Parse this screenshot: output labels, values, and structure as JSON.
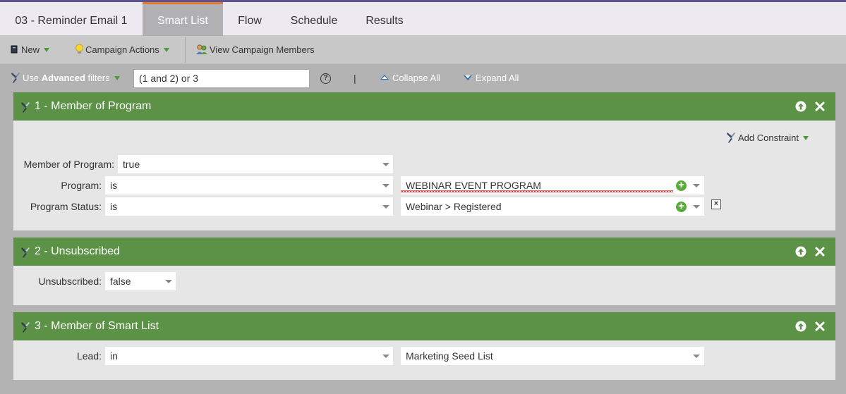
{
  "tabs": {
    "program_title": "03 - Reminder Email 1",
    "items": [
      "Smart List",
      "Flow",
      "Schedule",
      "Results"
    ],
    "active": "Smart List"
  },
  "toolbar": {
    "new_label": "New",
    "campaign_actions_label": "Campaign Actions",
    "view_members_label": "View Campaign Members"
  },
  "filter_bar": {
    "use_label": "Use",
    "advanced_label": "Advanced",
    "filters_label": "filters",
    "logic_value": "(1 and 2) or 3",
    "pipe": "|",
    "collapse_all": "Collapse All",
    "expand_all": "Expand All"
  },
  "filters": [
    {
      "title": "1 - Member of Program",
      "add_constraint": "Add Constraint",
      "rows": [
        {
          "label": "Member of Program:",
          "operator": "true"
        },
        {
          "label": "Program:",
          "operator": "is",
          "value": "WEBINAR EVENT PROGRAM"
        },
        {
          "label": "Program Status:",
          "operator": "is",
          "value": "Webinar > Registered"
        }
      ]
    },
    {
      "title": "2 - Unsubscribed",
      "rows": [
        {
          "label": "Unsubscribed:",
          "operator": "false"
        }
      ]
    },
    {
      "title": "3 - Member of Smart List",
      "rows": [
        {
          "label": "Lead:",
          "operator": "in",
          "value": "Marketing Seed List"
        }
      ]
    }
  ],
  "colors": {
    "panel_header": "#5c9246",
    "active_tab": "#b1b0b2",
    "tab_accent": "#e8782e",
    "background": "#b4b3b4"
  }
}
